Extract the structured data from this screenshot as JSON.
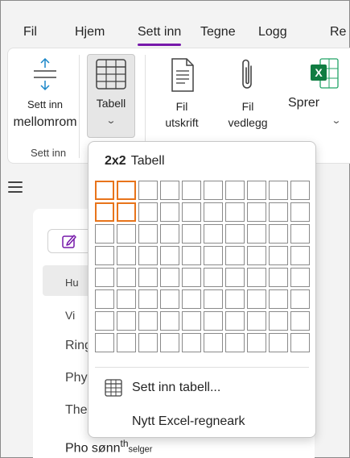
{
  "tabs": [
    {
      "label": "Fil"
    },
    {
      "label": "Hjem"
    },
    {
      "label": "Sett inn"
    },
    {
      "label": "Tegne"
    },
    {
      "label": "Logg"
    },
    {
      "label": "Re"
    }
  ],
  "active_tab": "Sett inn",
  "ribbon": {
    "insert_space": {
      "line1": "Sett inn",
      "line2": "mellomrom"
    },
    "group_label": "Sett inn",
    "table": {
      "label": "Tabell"
    },
    "file_printout": {
      "line1": "Fil",
      "line2": "utskrift"
    },
    "file_attachment": {
      "line1": "Fil",
      "line2": "vedlegg"
    },
    "spreadsheet": {
      "label": "Sprer"
    }
  },
  "pages": [
    {
      "label": "Hu"
    },
    {
      "label": "Vi"
    },
    {
      "label": "Ring"
    },
    {
      "label": "Phy"
    },
    {
      "label": "The"
    },
    {
      "label": "Pho sønn",
      "suffix": "th",
      "sub": "selger"
    }
  ],
  "dropdown": {
    "size_label": "2x2",
    "title": "Tabell",
    "grid": {
      "columns": 10,
      "rows": 8,
      "selected_columns": 2,
      "selected_rows": 2
    },
    "insert_table": "Sett inn tabell...",
    "new_excel": "Nytt Excel-regneark"
  },
  "colors": {
    "accent": "#7719aa",
    "grid_highlight": "#e8741b",
    "excel_green": "#107c41"
  }
}
